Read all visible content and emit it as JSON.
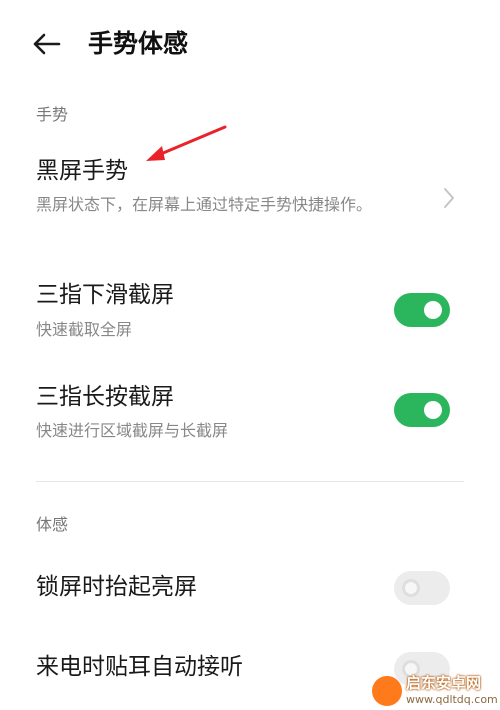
{
  "header": {
    "title": "手势体感",
    "back_icon": "back-arrow-icon"
  },
  "sections": {
    "gestures_label": "手势",
    "motion_label": "体感"
  },
  "items": {
    "screen_off_gesture": {
      "title": "黑屏手势",
      "description": "黑屏状态下，在屏幕上通过特定手势快捷操作。",
      "icon": "chevron-right-icon"
    },
    "three_finger_swipe": {
      "title": "三指下滑截屏",
      "description": "快速截取全屏",
      "toggle": "on"
    },
    "three_finger_hold": {
      "title": "三指长按截屏",
      "description": "快速进行区域截屏与长截屏",
      "toggle": "on"
    },
    "raise_to_wake": {
      "title": "锁屏时抬起亮屏",
      "toggle": "off"
    },
    "ear_answer": {
      "title": "来电时贴耳自动接听",
      "toggle": "off"
    }
  },
  "colors": {
    "toggle_on": "#2bb55d",
    "toggle_off": "#ececec",
    "annotation_arrow": "#e8242a"
  },
  "watermark": {
    "name": "启东安卓网",
    "url": "www.qdltdq.com"
  }
}
